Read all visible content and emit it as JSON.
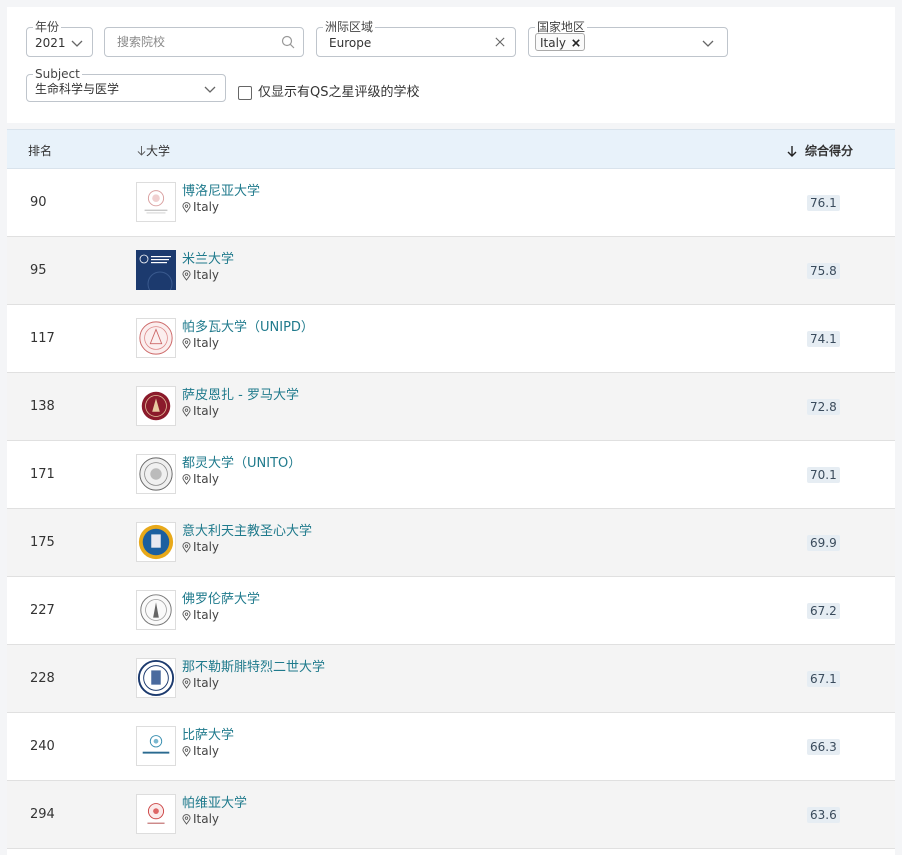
{
  "filters": {
    "year": {
      "label": "年份",
      "value": "2021"
    },
    "search": {
      "placeholder": "搜索院校"
    },
    "region": {
      "label": "洲际区域",
      "value": "Europe"
    },
    "country": {
      "label": "国家地区",
      "chip": "Italy"
    },
    "subject": {
      "label": "Subject",
      "value": "生命科学与医学"
    },
    "qs_stars_checkbox": {
      "label": "仅显示有QS之星评级的学校",
      "checked": false
    }
  },
  "table": {
    "headers": {
      "rank": "排名",
      "university": "大学",
      "score": "综合得分"
    },
    "rows": [
      {
        "rank": "90",
        "name": "博洛尼亚大学",
        "country": "Italy",
        "score": "76.1",
        "logo": "bologna-seal"
      },
      {
        "rank": "95",
        "name": "米兰大学",
        "country": "Italy",
        "score": "75.8",
        "logo": "milan-logo"
      },
      {
        "rank": "117",
        "name": "帕多瓦大学（UNIPD）",
        "country": "Italy",
        "score": "74.1",
        "logo": "padova-seal"
      },
      {
        "rank": "138",
        "name": "萨皮恩扎 - 罗马大学",
        "country": "Italy",
        "score": "72.8",
        "logo": "sapienza-seal"
      },
      {
        "rank": "171",
        "name": "都灵大学（UNITO）",
        "country": "Italy",
        "score": "70.1",
        "logo": "torino-seal"
      },
      {
        "rank": "175",
        "name": "意大利天主教圣心大学",
        "country": "Italy",
        "score": "69.9",
        "logo": "cattolica-seal"
      },
      {
        "rank": "227",
        "name": "佛罗伦萨大学",
        "country": "Italy",
        "score": "67.2",
        "logo": "firenze-seal"
      },
      {
        "rank": "228",
        "name": "那不勒斯腓特烈二世大学",
        "country": "Italy",
        "score": "67.1",
        "logo": "napoli-seal"
      },
      {
        "rank": "240",
        "name": "比萨大学",
        "country": "Italy",
        "score": "66.3",
        "logo": "pisa-logo"
      },
      {
        "rank": "294",
        "name": "帕维亚大学",
        "country": "Italy",
        "score": "63.6",
        "logo": "pavia-seal"
      }
    ]
  }
}
